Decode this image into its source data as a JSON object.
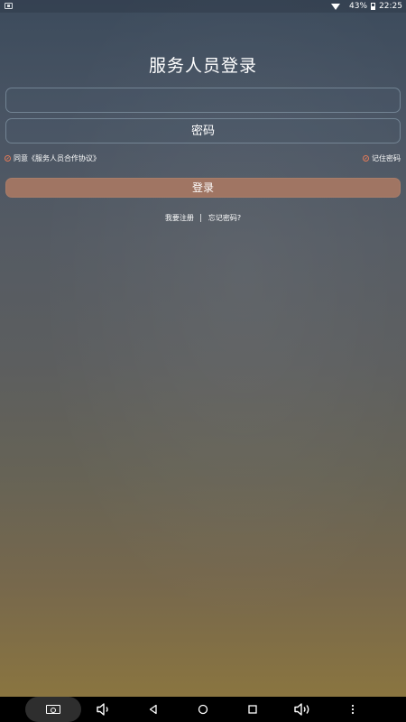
{
  "status_bar": {
    "battery": "43%",
    "time": "22:25"
  },
  "login": {
    "title": "服务人员登录",
    "account_placeholder": "",
    "password_placeholder": "密码",
    "agree_label": "同意《服务人员合作协议》",
    "remember_label": "记住密码",
    "login_button": "登录",
    "register_link": "我要注册",
    "forgot_link": "忘记密码?"
  },
  "colors": {
    "accent": "#a07563",
    "check": "#e07a5a"
  },
  "icons": {
    "status": [
      "sim-icon",
      "wifi-icon",
      "battery-icon"
    ],
    "nav": [
      "screenshot-icon",
      "volume-down-icon",
      "back-icon",
      "home-icon",
      "recents-icon",
      "volume-up-icon",
      "more-icon"
    ]
  }
}
